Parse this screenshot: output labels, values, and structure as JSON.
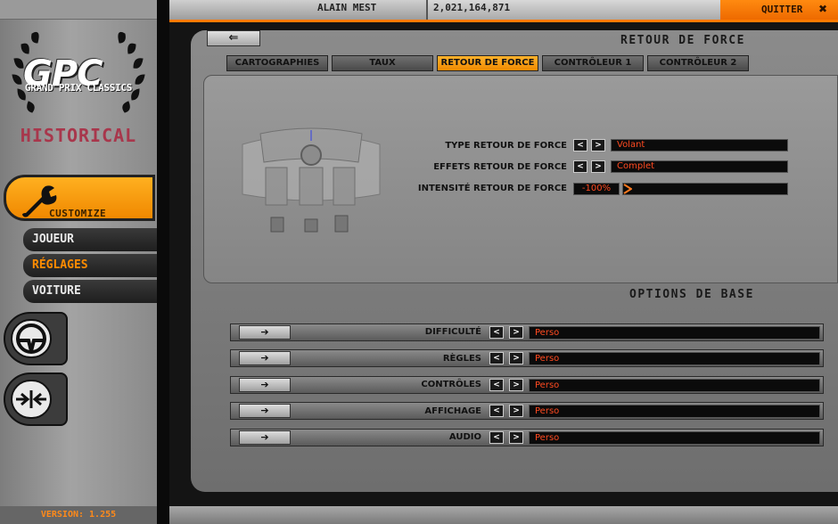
{
  "sidebar": {
    "logo_text": "GPC",
    "logo_subtitle": "GRAND PRIX CLASSICS",
    "logo_historical": "HISTORICAL",
    "customize_label": "CUSTOMIZE",
    "menu": [
      {
        "label": "JOUEUR",
        "active": false
      },
      {
        "label": "RÉGLAGES",
        "active": true
      },
      {
        "label": "VOITURE",
        "active": false
      }
    ],
    "version": "VERSION: 1.255"
  },
  "topbar": {
    "username": "ALAIN MEST",
    "credits": "2,021,164,871",
    "quit_label": "QUITTER",
    "quit_icon": "✖"
  },
  "main": {
    "back_icon": "⇐",
    "section_title": "RETOUR DE FORCE",
    "tabs": [
      {
        "label": "CARTOGRAPHIES",
        "active": false
      },
      {
        "label": "TAUX",
        "active": false
      },
      {
        "label": "RETOUR DE FORCE",
        "active": true
      },
      {
        "label": "CONTRÔLEUR 1",
        "active": false
      },
      {
        "label": "CONTRÔLEUR 2",
        "active": false
      }
    ],
    "ffb": {
      "type_label": "TYPE RETOUR DE FORCE",
      "type_value": "Volant",
      "effects_label": "EFFETS RETOUR DE FORCE",
      "effects_value": "Complet",
      "intensity_label": "INTENSITÉ RETOUR DE FORCE",
      "intensity_value": "-100%"
    },
    "options_title": "OPTIONS DE BASE",
    "options": [
      {
        "label": "DIFFICULTÉ",
        "value": "Perso"
      },
      {
        "label": "RÈGLES",
        "value": "Perso"
      },
      {
        "label": "CONTRÔLES",
        "value": "Perso"
      },
      {
        "label": "AFFICHAGE",
        "value": "Perso"
      },
      {
        "label": "AUDIO",
        "value": "Perso"
      }
    ],
    "arrow_left": "<",
    "arrow_right": ">",
    "row_button_icon": "➔"
  },
  "colors": {
    "accent": "#ff8a10",
    "value_text": "#ff4a20"
  }
}
